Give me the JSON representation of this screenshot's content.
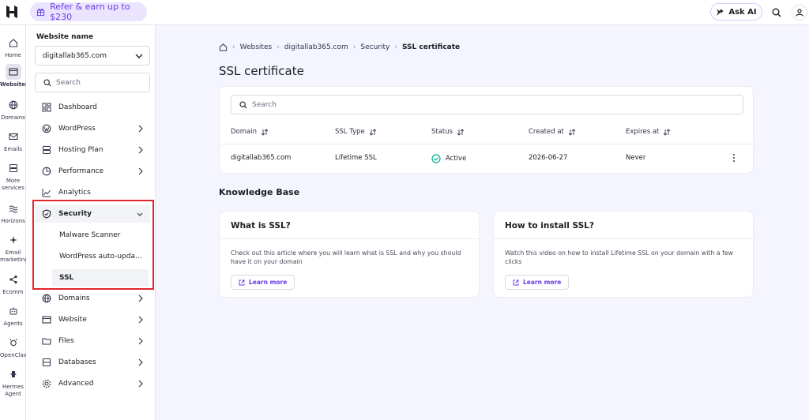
{
  "topbar": {
    "refer_label": "Refer & earn up to $230",
    "ask_ai_label": "Ask AI"
  },
  "rail": {
    "items": [
      {
        "label": "Home",
        "icon": "home-icon"
      },
      {
        "label": "Websites",
        "icon": "websites-icon"
      },
      {
        "label": "Domains",
        "icon": "globe-icon"
      },
      {
        "label": "Emails",
        "icon": "mail-icon"
      },
      {
        "label": "More services",
        "icon": "server-icon"
      },
      {
        "label": "Horizons",
        "icon": "horizons-icon"
      },
      {
        "label": "Email marketing",
        "icon": "email-marketing-icon"
      },
      {
        "label": "Ecomm",
        "icon": "share-icon"
      },
      {
        "label": "Agents",
        "icon": "robot-icon"
      },
      {
        "label": "OpenClaw",
        "icon": "claw-icon"
      },
      {
        "label": "Hermes Agent",
        "icon": "hermes-icon"
      }
    ]
  },
  "sidebar": {
    "title": "Website name",
    "site": "digitallab365.com",
    "search_placeholder": "Search",
    "items": [
      {
        "label": "Dashboard"
      },
      {
        "label": "WordPress"
      },
      {
        "label": "Hosting Plan"
      },
      {
        "label": "Performance"
      },
      {
        "label": "Analytics"
      },
      {
        "label": "Security"
      },
      {
        "label": "Domains"
      },
      {
        "label": "Website"
      },
      {
        "label": "Files"
      },
      {
        "label": "Databases"
      },
      {
        "label": "Advanced"
      }
    ],
    "security_sub": [
      {
        "label": "Malware Scanner"
      },
      {
        "label": "WordPress auto-upda…"
      },
      {
        "label": "SSL"
      }
    ]
  },
  "breadcrumb": [
    "Websites",
    "digitallab365.com",
    "Security",
    "SSL certificate"
  ],
  "page_title": "SSL certificate",
  "table": {
    "search_placeholder": "Search",
    "headers": [
      "Domain",
      "SSL Type",
      "Status",
      "Created at",
      "Expires at"
    ],
    "rows": [
      {
        "domain": "digitallab365.com",
        "type": "Lifetime SSL",
        "status": "Active",
        "created": "2026-06-27",
        "expires": "Never"
      }
    ]
  },
  "knowledge_base": {
    "title": "Knowledge Base",
    "cards": [
      {
        "title": "What is SSL?",
        "text": "Check out this article where you will learn what is SSL and why you should have it on your domain",
        "button": "Learn more"
      },
      {
        "title": "How to install SSL?",
        "text": "Watch this video on how to install Lifetime SSL on your domain with a few clicks",
        "button": "Learn more"
      }
    ]
  },
  "colors": {
    "accent": "#673de6",
    "active": "#00b090",
    "highlight": "#e1262c"
  }
}
